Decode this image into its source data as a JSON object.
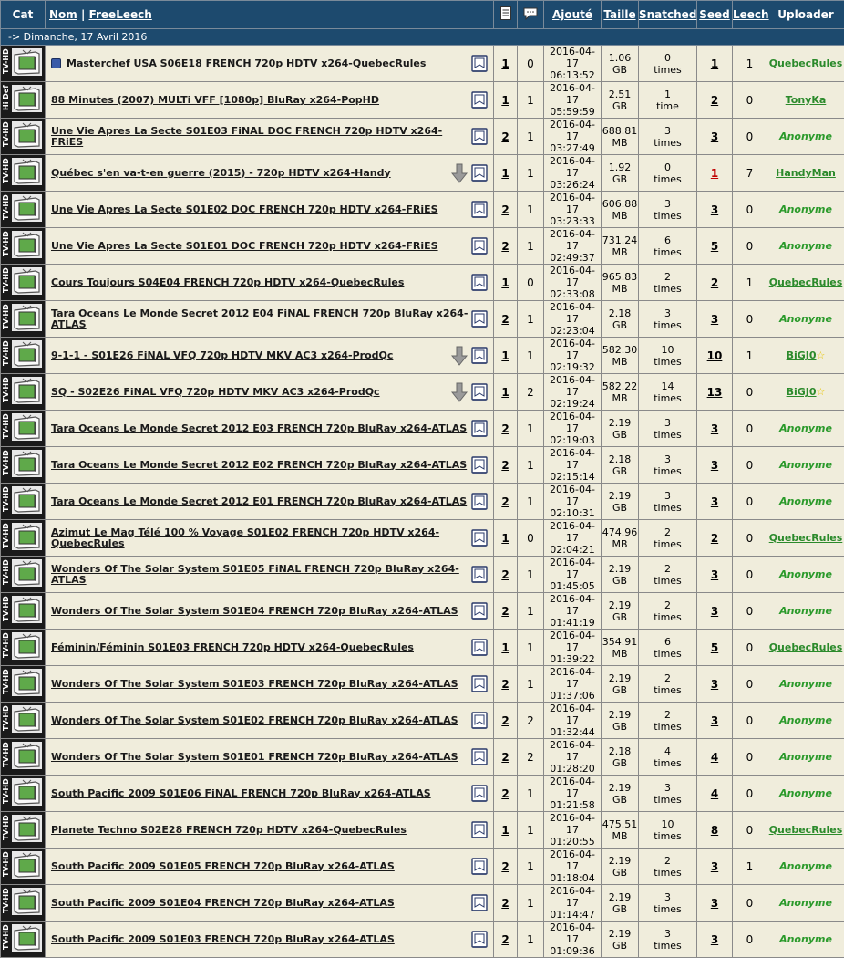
{
  "header": {
    "cat": "Cat",
    "nom": "Nom",
    "sep": "|",
    "freeleech": "FreeLeech",
    "ajoute": "Ajouté",
    "taille": "Taille",
    "snatched": "Snatched",
    "seed": "Seed",
    "leech": "Leech",
    "uploader": "Uploader"
  },
  "date_header": "-> Dimanche, 17 Avril 2016",
  "rows": [
    {
      "cat": "TV-HD",
      "name": "Masterchef USA S06E18 FRENCH 720p HDTV x264-QuebecRules",
      "new": true,
      "dl": false,
      "files": "1",
      "comments": "0",
      "date": "2016-04-17",
      "time": "06:13:52",
      "size": "1.06",
      "unit": "GB",
      "snatched": "0",
      "times": "times",
      "seed": "1",
      "leech": "1",
      "uploader": "QuebecRules",
      "anon": false,
      "star": false
    },
    {
      "cat": "Hi Def",
      "name": "88 Minutes (2007) MULTi VFF [1080p] BluRay x264-PopHD",
      "new": false,
      "dl": false,
      "files": "1",
      "comments": "1",
      "date": "2016-04-17",
      "time": "05:59:59",
      "size": "2.51",
      "unit": "GB",
      "snatched": "1",
      "times": "time",
      "seed": "2",
      "leech": "0",
      "uploader": "TonyKa",
      "anon": false,
      "star": false
    },
    {
      "cat": "TV-HD",
      "name": "Une Vie Apres La Secte S01E03 FiNAL DOC FRENCH 720p HDTV x264-FRiES",
      "new": false,
      "dl": false,
      "files": "2",
      "comments": "1",
      "date": "2016-04-17",
      "time": "03:27:49",
      "size": "688.81",
      "unit": "MB",
      "snatched": "3",
      "times": "times",
      "seed": "3",
      "leech": "0",
      "uploader": "Anonyme",
      "anon": true,
      "star": false
    },
    {
      "cat": "TV-HD",
      "name": "Québec s'en va-t-en guerre (2015) - 720p HDTV x264-Handy",
      "new": false,
      "dl": true,
      "files": "1",
      "comments": "1",
      "date": "2016-04-17",
      "time": "03:26:24",
      "size": "1.92",
      "unit": "GB",
      "snatched": "0",
      "times": "times",
      "seed": "1",
      "leech": "7",
      "uploader": "HandyMan",
      "anon": false,
      "star": false,
      "seedred": true
    },
    {
      "cat": "TV-HD",
      "name": "Une Vie Apres La Secte S01E02 DOC FRENCH 720p HDTV x264-FRiES",
      "new": false,
      "dl": false,
      "files": "2",
      "comments": "1",
      "date": "2016-04-17",
      "time": "03:23:33",
      "size": "606.88",
      "unit": "MB",
      "snatched": "3",
      "times": "times",
      "seed": "3",
      "leech": "0",
      "uploader": "Anonyme",
      "anon": true,
      "star": false
    },
    {
      "cat": "TV-HD",
      "name": "Une Vie Apres La Secte S01E01 DOC FRENCH 720p HDTV x264-FRiES",
      "new": false,
      "dl": false,
      "files": "2",
      "comments": "1",
      "date": "2016-04-17",
      "time": "02:49:37",
      "size": "731.24",
      "unit": "MB",
      "snatched": "6",
      "times": "times",
      "seed": "5",
      "leech": "0",
      "uploader": "Anonyme",
      "anon": true,
      "star": false
    },
    {
      "cat": "TV-HD",
      "name": "Cours Toujours S04E04 FRENCH 720p HDTV x264-QuebecRules",
      "new": false,
      "dl": false,
      "files": "1",
      "comments": "0",
      "date": "2016-04-17",
      "time": "02:33:08",
      "size": "965.83",
      "unit": "MB",
      "snatched": "2",
      "times": "times",
      "seed": "2",
      "leech": "1",
      "uploader": "QuebecRules",
      "anon": false,
      "star": false
    },
    {
      "cat": "TV-HD",
      "name": "Tara Oceans Le Monde Secret 2012 E04 FiNAL FRENCH 720p BluRay x264-ATLAS",
      "new": false,
      "dl": false,
      "files": "2",
      "comments": "1",
      "date": "2016-04-17",
      "time": "02:23:04",
      "size": "2.18",
      "unit": "GB",
      "snatched": "3",
      "times": "times",
      "seed": "3",
      "leech": "0",
      "uploader": "Anonyme",
      "anon": true,
      "star": false
    },
    {
      "cat": "TV-HD",
      "name": "9-1-1 - S01E26 FiNAL VFQ 720p HDTV MKV AC3 x264-ProdQc",
      "new": false,
      "dl": true,
      "files": "1",
      "comments": "1",
      "date": "2016-04-17",
      "time": "02:19:32",
      "size": "582.30",
      "unit": "MB",
      "snatched": "10",
      "times": "times",
      "seed": "10",
      "leech": "1",
      "uploader": "BiGJ0",
      "anon": false,
      "star": true
    },
    {
      "cat": "TV-HD",
      "name": "SQ - S02E26 FiNAL VFQ 720p HDTV MKV AC3 x264-ProdQc",
      "new": false,
      "dl": true,
      "files": "1",
      "comments": "2",
      "date": "2016-04-17",
      "time": "02:19:24",
      "size": "582.22",
      "unit": "MB",
      "snatched": "14",
      "times": "times",
      "seed": "13",
      "leech": "0",
      "uploader": "BiGJ0",
      "anon": false,
      "star": true
    },
    {
      "cat": "TV-HD",
      "name": "Tara Oceans Le Monde Secret 2012 E03 FRENCH 720p BluRay x264-ATLAS",
      "new": false,
      "dl": false,
      "files": "2",
      "comments": "1",
      "date": "2016-04-17",
      "time": "02:19:03",
      "size": "2.19",
      "unit": "GB",
      "snatched": "3",
      "times": "times",
      "seed": "3",
      "leech": "0",
      "uploader": "Anonyme",
      "anon": true,
      "star": false
    },
    {
      "cat": "TV-HD",
      "name": "Tara Oceans Le Monde Secret 2012 E02 FRENCH 720p BluRay x264-ATLAS",
      "new": false,
      "dl": false,
      "files": "2",
      "comments": "1",
      "date": "2016-04-17",
      "time": "02:15:14",
      "size": "2.18",
      "unit": "GB",
      "snatched": "3",
      "times": "times",
      "seed": "3",
      "leech": "0",
      "uploader": "Anonyme",
      "anon": true,
      "star": false
    },
    {
      "cat": "TV-HD",
      "name": "Tara Oceans Le Monde Secret 2012 E01 FRENCH 720p BluRay x264-ATLAS",
      "new": false,
      "dl": false,
      "files": "2",
      "comments": "1",
      "date": "2016-04-17",
      "time": "02:10:31",
      "size": "2.19",
      "unit": "GB",
      "snatched": "3",
      "times": "times",
      "seed": "3",
      "leech": "0",
      "uploader": "Anonyme",
      "anon": true,
      "star": false
    },
    {
      "cat": "TV-HD",
      "name": "Azimut Le Mag Télé 100 % Voyage S01E02 FRENCH 720p HDTV x264-QuebecRules",
      "new": false,
      "dl": false,
      "files": "1",
      "comments": "0",
      "date": "2016-04-17",
      "time": "02:04:21",
      "size": "474.96",
      "unit": "MB",
      "snatched": "2",
      "times": "times",
      "seed": "2",
      "leech": "0",
      "uploader": "QuebecRules",
      "anon": false,
      "star": false
    },
    {
      "cat": "TV-HD",
      "name": "Wonders Of The Solar System S01E05 FiNAL FRENCH 720p BluRay x264-ATLAS",
      "new": false,
      "dl": false,
      "files": "2",
      "comments": "1",
      "date": "2016-04-17",
      "time": "01:45:05",
      "size": "2.19",
      "unit": "GB",
      "snatched": "2",
      "times": "times",
      "seed": "3",
      "leech": "0",
      "uploader": "Anonyme",
      "anon": true,
      "star": false
    },
    {
      "cat": "TV-HD",
      "name": "Wonders Of The Solar System S01E04 FRENCH 720p BluRay x264-ATLAS",
      "new": false,
      "dl": false,
      "files": "2",
      "comments": "1",
      "date": "2016-04-17",
      "time": "01:41:19",
      "size": "2.19",
      "unit": "GB",
      "snatched": "2",
      "times": "times",
      "seed": "3",
      "leech": "0",
      "uploader": "Anonyme",
      "anon": true,
      "star": false
    },
    {
      "cat": "TV-HD",
      "name": "Féminin/Féminin S01E03 FRENCH 720p HDTV x264-QuebecRules",
      "new": false,
      "dl": false,
      "files": "1",
      "comments": "1",
      "date": "2016-04-17",
      "time": "01:39:22",
      "size": "354.91",
      "unit": "MB",
      "snatched": "6",
      "times": "times",
      "seed": "5",
      "leech": "0",
      "uploader": "QuebecRules",
      "anon": false,
      "star": false
    },
    {
      "cat": "TV-HD",
      "name": "Wonders Of The Solar System S01E03 FRENCH 720p BluRay x264-ATLAS",
      "new": false,
      "dl": false,
      "files": "2",
      "comments": "1",
      "date": "2016-04-17",
      "time": "01:37:06",
      "size": "2.19",
      "unit": "GB",
      "snatched": "2",
      "times": "times",
      "seed": "3",
      "leech": "0",
      "uploader": "Anonyme",
      "anon": true,
      "star": false
    },
    {
      "cat": "TV-HD",
      "name": "Wonders Of The Solar System S01E02 FRENCH 720p BluRay x264-ATLAS",
      "new": false,
      "dl": false,
      "files": "2",
      "comments": "2",
      "date": "2016-04-17",
      "time": "01:32:44",
      "size": "2.19",
      "unit": "GB",
      "snatched": "2",
      "times": "times",
      "seed": "3",
      "leech": "0",
      "uploader": "Anonyme",
      "anon": true,
      "star": false
    },
    {
      "cat": "TV-HD",
      "name": "Wonders Of The Solar System S01E01 FRENCH 720p BluRay x264-ATLAS",
      "new": false,
      "dl": false,
      "files": "2",
      "comments": "2",
      "date": "2016-04-17",
      "time": "01:28:20",
      "size": "2.18",
      "unit": "GB",
      "snatched": "4",
      "times": "times",
      "seed": "4",
      "leech": "0",
      "uploader": "Anonyme",
      "anon": true,
      "star": false
    },
    {
      "cat": "TV-HD",
      "name": "South Pacific 2009 S01E06 FiNAL FRENCH 720p BluRay x264-ATLAS",
      "new": false,
      "dl": false,
      "files": "2",
      "comments": "1",
      "date": "2016-04-17",
      "time": "01:21:58",
      "size": "2.19",
      "unit": "GB",
      "snatched": "3",
      "times": "times",
      "seed": "4",
      "leech": "0",
      "uploader": "Anonyme",
      "anon": true,
      "star": false
    },
    {
      "cat": "TV-HD",
      "name": "Planete Techno S02E28 FRENCH 720p HDTV x264-QuebecRules",
      "new": false,
      "dl": false,
      "files": "1",
      "comments": "1",
      "date": "2016-04-17",
      "time": "01:20:55",
      "size": "475.51",
      "unit": "MB",
      "snatched": "10",
      "times": "times",
      "seed": "8",
      "leech": "0",
      "uploader": "QuebecRules",
      "anon": false,
      "star": false
    },
    {
      "cat": "TV-HD",
      "name": "South Pacific 2009 S01E05 FRENCH 720p BluRay x264-ATLAS",
      "new": false,
      "dl": false,
      "files": "2",
      "comments": "1",
      "date": "2016-04-17",
      "time": "01:18:04",
      "size": "2.19",
      "unit": "GB",
      "snatched": "2",
      "times": "times",
      "seed": "3",
      "leech": "1",
      "uploader": "Anonyme",
      "anon": true,
      "star": false
    },
    {
      "cat": "TV-HD",
      "name": "South Pacific 2009 S01E04 FRENCH 720p BluRay x264-ATLAS",
      "new": false,
      "dl": false,
      "files": "2",
      "comments": "1",
      "date": "2016-04-17",
      "time": "01:14:47",
      "size": "2.19",
      "unit": "GB",
      "snatched": "3",
      "times": "times",
      "seed": "3",
      "leech": "0",
      "uploader": "Anonyme",
      "anon": true,
      "star": false
    },
    {
      "cat": "TV-HD",
      "name": "South Pacific 2009 S01E03 FRENCH 720p BluRay x264-ATLAS",
      "new": false,
      "dl": false,
      "files": "2",
      "comments": "1",
      "date": "2016-04-17",
      "time": "01:09:36",
      "size": "2.19",
      "unit": "GB",
      "snatched": "3",
      "times": "times",
      "seed": "3",
      "leech": "0",
      "uploader": "Anonyme",
      "anon": true,
      "star": false
    }
  ]
}
